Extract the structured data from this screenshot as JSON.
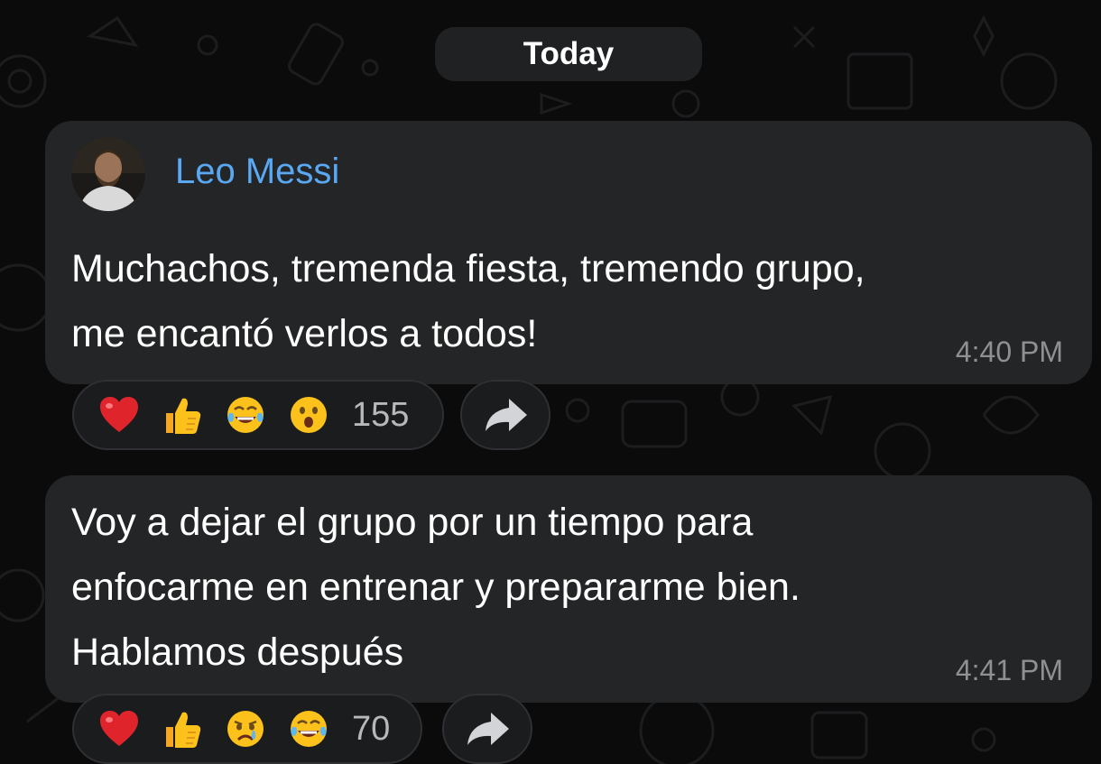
{
  "date_divider": "Today",
  "messages": [
    {
      "sender": "Leo Messi",
      "avatar": "avatar-photo",
      "text": "Muchachos, tremenda fiesta, tremendo grupo,\nme encantó verlos a todos!",
      "time": "4:40 PM",
      "reactions": [
        "red-heart",
        "thumbs-up",
        "face-with-tears-of-joy",
        "face-with-open-mouth"
      ],
      "reaction_count": "155"
    },
    {
      "text": "Voy a dejar el grupo por un tiempo para\nenfocarme en entrenar y prepararme bien.\nHablamos después",
      "time": "4:41 PM",
      "reactions": [
        "red-heart",
        "thumbs-up",
        "crying-face",
        "face-with-tears-of-joy"
      ],
      "reaction_count": "70"
    }
  ],
  "colors": {
    "background": "#0b0b0c",
    "bubble": "#232526",
    "sender_name": "#5aa7f2",
    "timestamp": "#8e9093"
  }
}
